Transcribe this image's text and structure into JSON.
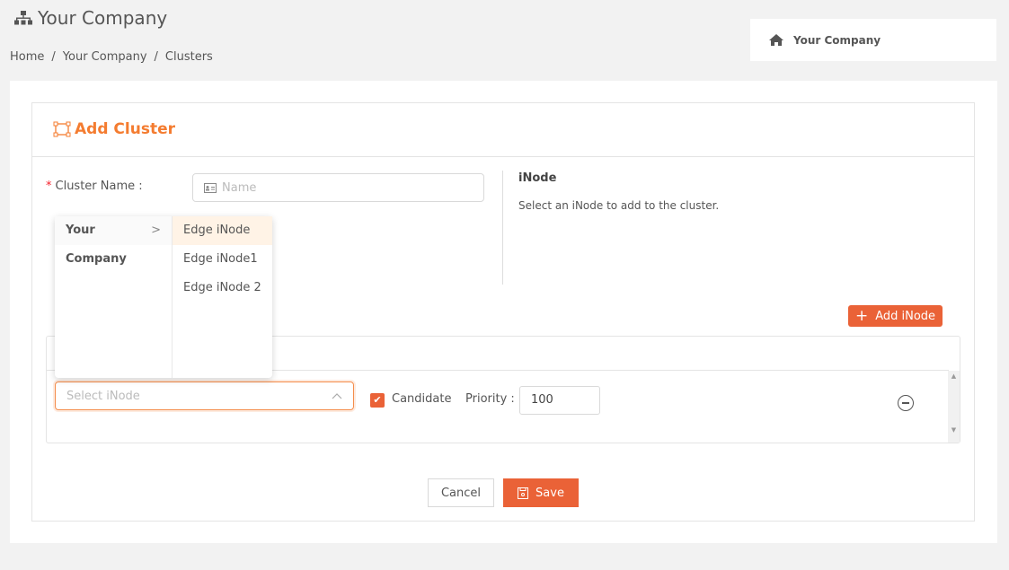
{
  "header": {
    "title": "Your Company",
    "breadcrumb": [
      "Home",
      "Your Company",
      "Clusters"
    ],
    "org_card": "Your Company"
  },
  "form": {
    "title": "Add Cluster",
    "cluster_name_label": "Cluster Name",
    "cluster_name_placeholder": "Name",
    "inode_heading": "iNode",
    "inode_description": "Select an iNode to add to the cluster.",
    "add_inode_label": "Add iNode",
    "row": {
      "select_placeholder": "Select iNode",
      "candidate_label": "Candidate",
      "candidate_checked": true,
      "priority_label": "Priority",
      "priority_value": "100"
    },
    "cancel_label": "Cancel",
    "save_label": "Save"
  },
  "dropdown": {
    "org": "Your Company",
    "options": [
      "Edge iNode",
      "Edge iNode1",
      "Edge iNode 2"
    ],
    "highlighted": "Edge iNode"
  },
  "colors": {
    "accent": "#ea6237",
    "title": "#f47c30"
  }
}
